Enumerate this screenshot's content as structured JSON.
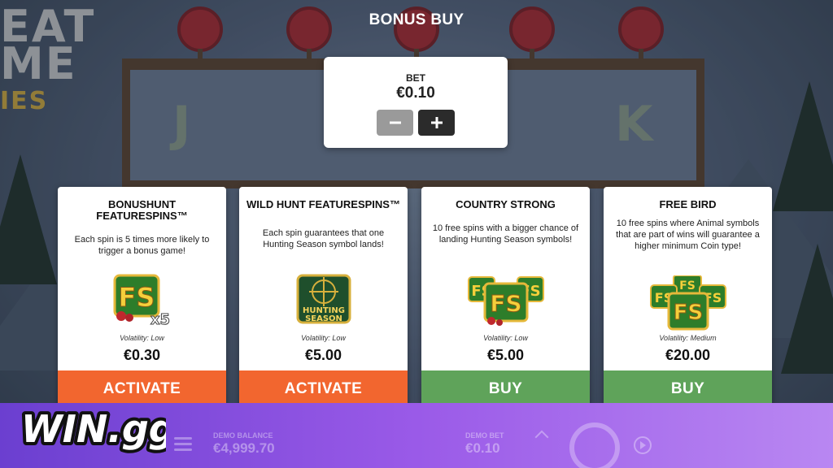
{
  "header": {
    "title": "BONUS BUY"
  },
  "bet": {
    "label": "BET",
    "value": "€0.10",
    "minus_icon": "minus-icon",
    "plus_icon": "plus-icon"
  },
  "cards": [
    {
      "title": "BONUSHUNT FEATURESPINS™",
      "description": "Each spin is 5 times more likely to trigger a bonus game!",
      "image_text": "FS",
      "image_badge": "x5",
      "volatility": "Volatility: Low",
      "price": "€0.30",
      "action": "ACTIVATE",
      "action_color": "#f2662f"
    },
    {
      "title": "WILD HUNT FEATURESPINS™",
      "description": "Each spin guarantees that one Hunting Season symbol lands!",
      "image_text_line1": "HUNTING",
      "image_text_line2": "SEASON",
      "volatility": "Volatility: Low",
      "price": "€5.00",
      "action": "ACTIVATE",
      "action_color": "#f2662f"
    },
    {
      "title": "COUNTRY STRONG",
      "description": "10 free spins with a bigger chance of landing Hunting Season symbols!",
      "image_text": "FS",
      "volatility": "Volatility: Low",
      "price": "€5.00",
      "action": "BUY",
      "action_color": "#5fa35a"
    },
    {
      "title": "FREE BIRD",
      "description": "10 free spins where Animal symbols that are part of wins will guarantee a higher minimum Coin type!",
      "image_text": "FS",
      "volatility": "Volatility: Medium",
      "price": "€20.00",
      "action": "BUY",
      "action_color": "#5fa35a"
    }
  ],
  "background": {
    "logo_lines": [
      "EAT",
      "ME"
    ],
    "logo_sub": "IES",
    "reel_symbols": [
      "J",
      "K"
    ]
  },
  "footer": {
    "brand": "WIN.gg",
    "demo_balance_label": "DEMO BALANCE",
    "demo_balance_value": "€4,999.70",
    "demo_bet_label": "DEMO BET",
    "demo_bet_value": "€0.10"
  },
  "colors": {
    "orange": "#f2662f",
    "green": "#5fa35a",
    "footer_purple": "#8a50e0"
  }
}
